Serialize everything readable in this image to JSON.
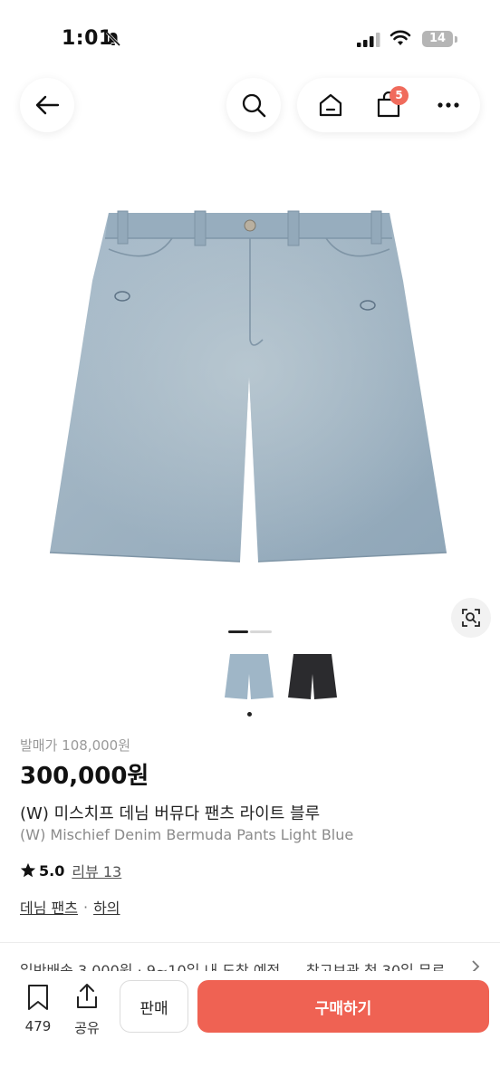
{
  "status_bar": {
    "time": "1:01",
    "battery": "14"
  },
  "nav": {
    "cart_count": "5"
  },
  "product": {
    "release_price_label": "발매가 108,000원",
    "price": "300,000원",
    "name_ko": "(W) 미스치프 데님 버뮤다 팬츠 라이트 블루",
    "name_en": "(W) Mischief Denim Bermuda Pants Light Blue",
    "rating": "5.0",
    "review_label": "리뷰 13",
    "tags": [
      "데님 팬츠",
      "하의"
    ],
    "tag_separator": "·",
    "image_index": 1,
    "image_count": 2,
    "colors": {
      "light_denim": "#9fb6c7",
      "black_denim": "#2b2b2e"
    }
  },
  "shipping_partial": {
    "left": "일반배송 3,000원 · 9~10일 내 도착 예정",
    "right": "창고보관 첫 30일 무료"
  },
  "bottom_bar": {
    "wish_count": "479",
    "share_label": "공유",
    "sell_label": "판매",
    "buy_label": "구매하기",
    "accent_color": "#ef6253"
  }
}
